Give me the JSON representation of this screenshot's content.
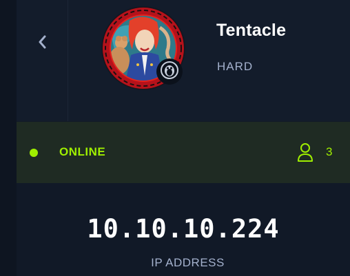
{
  "machine": {
    "name": "Tentacle",
    "difficulty": "HARD",
    "os_icon": "linux-penguin-icon"
  },
  "status": {
    "label": "ONLINE",
    "players": "3",
    "color": "#9fef00"
  },
  "connection": {
    "ip": "10.10.10.224",
    "ip_label": "IP ADDRESS"
  },
  "nav": {
    "back_icon": "chevron-left-icon"
  },
  "colors": {
    "background": "#111927",
    "accent": "#9fef00",
    "avatar_ring": "#e02020"
  }
}
